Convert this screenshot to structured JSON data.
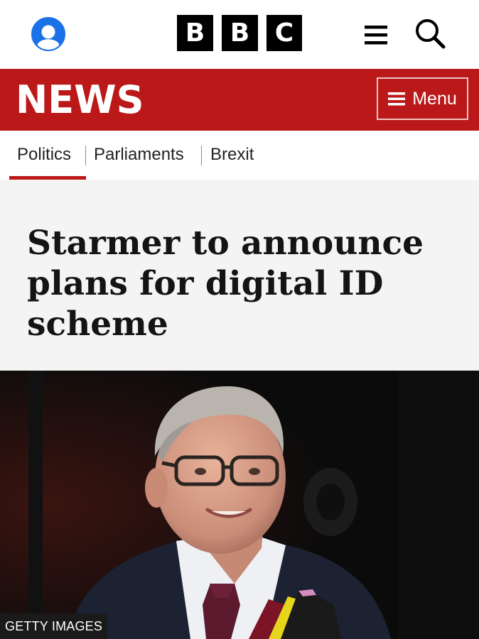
{
  "header": {
    "logo_letters": [
      "B",
      "B",
      "C"
    ],
    "icons": {
      "account": "account-icon",
      "menu": "hamburger-icon",
      "search": "search-icon"
    },
    "colors": {
      "account_blue": "#1b72e8",
      "logo_black": "#000000"
    }
  },
  "news_bar": {
    "wordmark": "NEWS",
    "menu_label": "Menu",
    "colors": {
      "background": "#bb1919"
    }
  },
  "nav": {
    "items": [
      {
        "label": "Politics",
        "active": true
      },
      {
        "label": "Parliaments",
        "active": false
      },
      {
        "label": "Brexit",
        "active": false
      }
    ]
  },
  "article": {
    "headline": "Starmer to announce plans for digital ID scheme",
    "image_credit": "GETTY IMAGES"
  }
}
